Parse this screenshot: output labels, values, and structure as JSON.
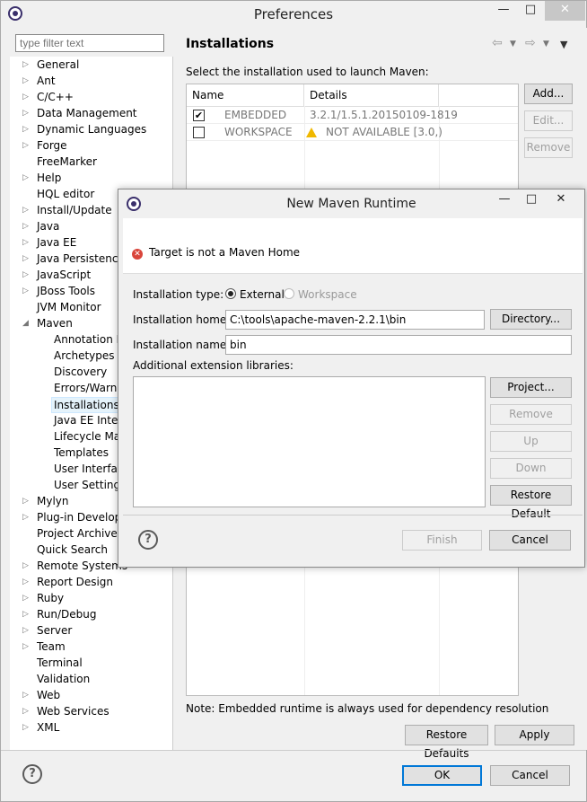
{
  "window": {
    "title": "Preferences"
  },
  "filter": {
    "placeholder": "type filter text"
  },
  "tree": {
    "items": [
      {
        "label": "General",
        "arrow": true
      },
      {
        "label": "Ant",
        "arrow": true
      },
      {
        "label": "C/C++",
        "arrow": true
      },
      {
        "label": "Data Management",
        "arrow": true
      },
      {
        "label": "Dynamic Languages",
        "arrow": true
      },
      {
        "label": "Forge",
        "arrow": true
      },
      {
        "label": "FreeMarker",
        "arrow": false
      },
      {
        "label": "Help",
        "arrow": true
      },
      {
        "label": "HQL editor",
        "arrow": false
      },
      {
        "label": "Install/Update",
        "arrow": true
      },
      {
        "label": "Java",
        "arrow": true
      },
      {
        "label": "Java EE",
        "arrow": true
      },
      {
        "label": "Java Persistence",
        "arrow": true
      },
      {
        "label": "JavaScript",
        "arrow": true
      },
      {
        "label": "JBoss Tools",
        "arrow": true
      },
      {
        "label": "JVM Monitor",
        "arrow": false
      },
      {
        "label": "Maven",
        "arrow": true,
        "expanded": true
      }
    ],
    "maven_children": [
      "Annotation P",
      "Archetypes",
      "Discovery",
      "Errors/Warnin",
      "Installations",
      "Java EE Integr",
      "Lifecycle Map",
      "Templates",
      "User Interface",
      "User Settings"
    ],
    "items_after": [
      {
        "label": "Mylyn",
        "arrow": true
      },
      {
        "label": "Plug-in Developm",
        "arrow": true
      },
      {
        "label": "Project Archives",
        "arrow": false
      },
      {
        "label": "Quick Search",
        "arrow": false
      },
      {
        "label": "Remote Systems",
        "arrow": true
      },
      {
        "label": "Report Design",
        "arrow": true
      },
      {
        "label": "Ruby",
        "arrow": true
      },
      {
        "label": "Run/Debug",
        "arrow": true
      },
      {
        "label": "Server",
        "arrow": true
      },
      {
        "label": "Team",
        "arrow": true
      },
      {
        "label": "Terminal",
        "arrow": false
      },
      {
        "label": "Validation",
        "arrow": false
      },
      {
        "label": "Web",
        "arrow": true
      },
      {
        "label": "Web Services",
        "arrow": true
      },
      {
        "label": "XML",
        "arrow": true
      }
    ]
  },
  "page": {
    "title": "Installations",
    "instruction": "Select the installation used to launch Maven:",
    "columns": {
      "name": "Name",
      "details": "Details"
    },
    "rows": [
      {
        "name": "EMBEDDED",
        "details": "3.2.1/1.5.1.20150109-1819",
        "checked": true
      },
      {
        "name": "WORKSPACE",
        "details": "NOT AVAILABLE [3.0,)",
        "checked": false
      }
    ],
    "buttons": {
      "add": "Add...",
      "edit": "Edit...",
      "remove": "Remove"
    },
    "note": "Note: Embedded runtime is always used for dependency resolution",
    "restore_defaults": "Restore Defaults",
    "apply": "Apply"
  },
  "footer": {
    "ok": "OK",
    "cancel": "Cancel"
  },
  "dialog": {
    "title": "New Maven Runtime",
    "message": "Target is not a Maven Home",
    "installation_type_label": "Installation type:",
    "type_external": "External",
    "type_workspace": "Workspace",
    "home_label": "Installation home:",
    "home_value": "C:\\tools\\apache-maven-2.2.1\\bin",
    "directory_button": "Directory...",
    "name_label": "Installation name:",
    "name_value": "bin",
    "ext_label": "Additional extension libraries:",
    "buttons": {
      "project": "Project...",
      "remove": "Remove",
      "up": "Up",
      "down": "Down",
      "restore": "Restore Default"
    },
    "finish": "Finish",
    "cancel": "Cancel"
  }
}
